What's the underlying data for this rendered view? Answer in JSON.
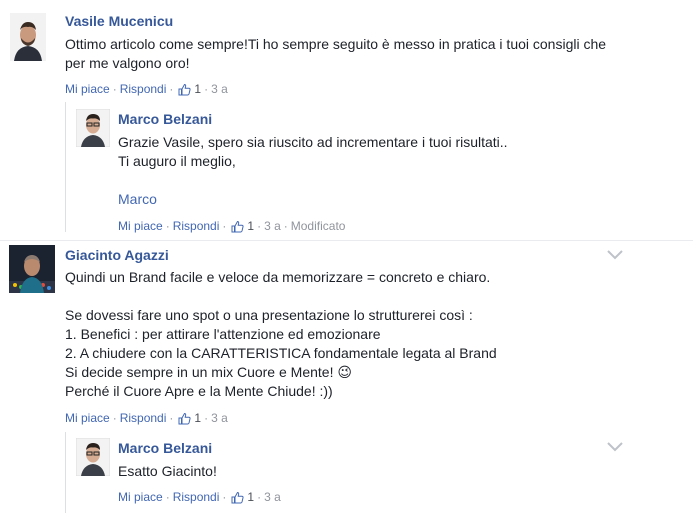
{
  "comments": [
    {
      "author": "Vasile Mucenicu",
      "text": "Ottimo articolo come sempre!Ti ho sempre seguito è messo in pratica i tuoi consigli che per me valgono oro!",
      "like_label": "Mi piace",
      "reply_label": "Rispondi",
      "likes": "1",
      "time": "3 a"
    },
    {
      "author": "Marco Belzani",
      "text": "Grazie Vasile, spero sia riuscito ad incrementare i tuoi risultati..\nTi auguro il meglio,",
      "signature": "Marco",
      "like_label": "Mi piace",
      "reply_label": "Rispondi",
      "likes": "1",
      "time": "3 a",
      "edited": "Modificato"
    },
    {
      "author": "Giacinto Agazzi",
      "text": "Quindi un Brand facile e veloce da memorizzare = concreto e chiaro.\n\nSe dovessi fare uno spot o una presentazione lo strutturerei così :\n1. Benefici : per attirare l'attenzione ed emozionare\n2. A chiudere con la CARATTERISTICA fondamentale legata al Brand\nSi decide sempre in un mix Cuore e Mente! 😉\nPerché il Cuore Apre e la Mente Chiude! :))",
      "like_label": "Mi piace",
      "reply_label": "Rispondi",
      "likes": "1",
      "time": "3 a"
    },
    {
      "author": "Marco Belzani",
      "text": "Esatto Giacinto!",
      "like_label": "Mi piace",
      "reply_label": "Rispondi",
      "likes": "1",
      "time": "3 a"
    }
  ],
  "colors": {
    "link": "#4267b2",
    "author": "#365899",
    "meta": "#90949c"
  },
  "icons": {
    "like": "thumbs-up-icon",
    "menu": "chevron-down-icon"
  }
}
